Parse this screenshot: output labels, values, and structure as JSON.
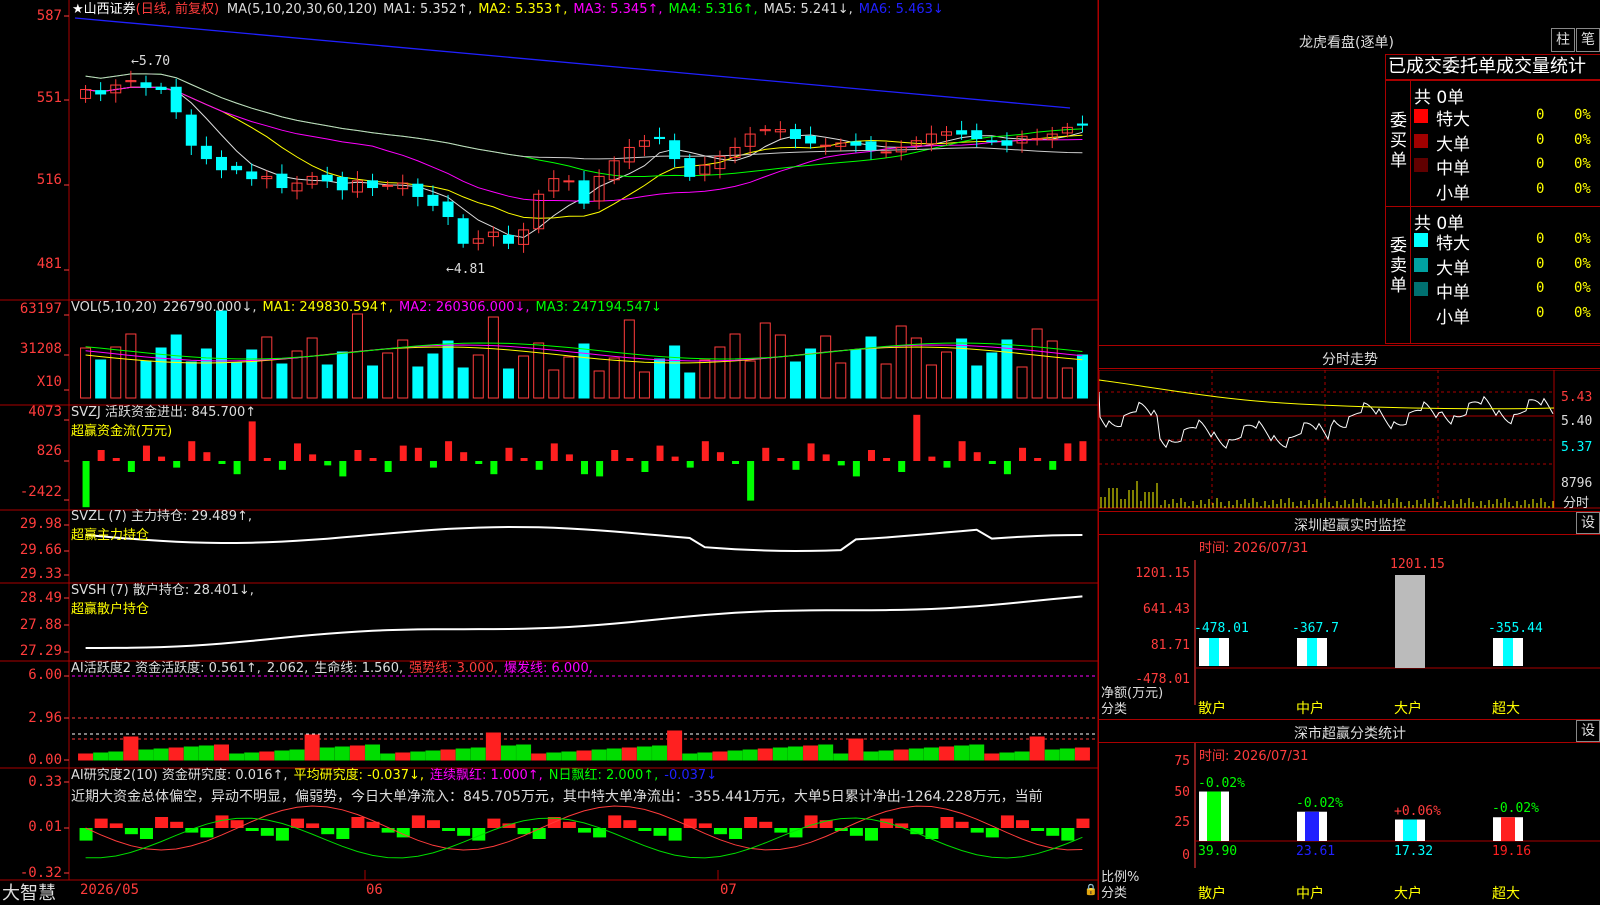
{
  "stock": {
    "name": "★山西证券",
    "period": "(日线, 前复权)"
  },
  "ma_header": [
    {
      "t": "MA(5,10,20,30,60,120)",
      "c": "#ddd"
    },
    {
      "t": "MA1: 5.352↑,",
      "c": "#ddd"
    },
    {
      "t": "MA2: 5.353↑,",
      "c": "#ffff00"
    },
    {
      "t": "MA3: 5.345↑,",
      "c": "#ff00ff"
    },
    {
      "t": "MA4: 5.316↑,",
      "c": "#00ff00"
    },
    {
      "t": "MA5: 5.241↓,",
      "c": "#ddd"
    },
    {
      "t": "MA6: 5.463↓",
      "c": "#2020ff"
    }
  ],
  "price_axis": [
    "587",
    "551",
    "516",
    "481"
  ],
  "price_annot": {
    "high": "5.70",
    "low": "4.81"
  },
  "vol_header": [
    {
      "t": "VOL(5,10,20)",
      "c": "#ddd"
    },
    {
      "t": "226790.000↓,",
      "c": "#ddd"
    },
    {
      "t": "MA1: 249830.594↑,",
      "c": "#ffff00"
    },
    {
      "t": "MA2: 260306.000↓,",
      "c": "#ff00ff"
    },
    {
      "t": "MA3: 247194.547↓",
      "c": "#00ff00"
    }
  ],
  "vol_axis": [
    "63197",
    "31208",
    "X10"
  ],
  "svzj": {
    "header": [
      {
        "t": "SVZJ  活跃资金进出: 845.700↑",
        "c": "#ddd"
      }
    ],
    "sub": "超赢资金流(万元)",
    "axis": [
      "4073",
      "826",
      "-2422"
    ]
  },
  "svzl": {
    "header": [
      {
        "t": "SVZL (7) 主力持仓: 29.489↑,",
        "c": "#ddd"
      }
    ],
    "sub": "超赢主力持仓",
    "axis": [
      "29.98",
      "29.66",
      "29.33"
    ]
  },
  "svsh": {
    "header": [
      {
        "t": "SVSH (7) 散户持仓: 28.401↓,",
        "c": "#ddd"
      }
    ],
    "sub": "超赢散户持仓",
    "axis": [
      "28.49",
      "27.88",
      "27.29"
    ]
  },
  "ai1": {
    "header": [
      {
        "t": "AI活跃度2 资金活跃度: 0.561↑,",
        "c": "#ddd"
      },
      {
        "t": "2.062,",
        "c": "#ddd"
      },
      {
        "t": "生命线: 1.560,",
        "c": "#ddd"
      },
      {
        "t": "强势线: 3.000,",
        "c": "#ff3c3c"
      },
      {
        "t": "爆发线: 6.000,",
        "c": "#ff00ff"
      }
    ],
    "axis": [
      "6.00",
      "2.96",
      "0.00"
    ]
  },
  "ai2": {
    "header": [
      {
        "t": "AI研究度2(10) 资金研究度: 0.016↑,",
        "c": "#ddd"
      },
      {
        "t": "平均研究度: -0.037↓,",
        "c": "#ffff00"
      },
      {
        "t": "连续飘红: 1.000↑,",
        "c": "#ff00ff"
      },
      {
        "t": "N日飘红: 2.000↑,",
        "c": "#00ff00"
      },
      {
        "t": "-0.037↓",
        "c": "#2020ff"
      }
    ],
    "note": "近期大资金总体偏空，异动不明显，偏弱势，今日大单净流入：845.705万元，其中特大单净流出：-355.441万元，大单5日累计净出-1264.228万元，当前",
    "axis": [
      "0.33",
      "0.01",
      "-0.32"
    ]
  },
  "bottom": {
    "brand": "大智慧",
    "dates": [
      "2026/05",
      "06",
      "07"
    ]
  },
  "dragon": {
    "title": "龙虎看盘(逐单)",
    "tab1": "柱",
    "tab2": "笔",
    "subtitle": "已成交委托单成交量统计",
    "buy_label": "委买单",
    "sell_label": "委卖单",
    "buy_total": "共 0单",
    "sell_total": "共 0单",
    "buy_rows": [
      {
        "name": "特大",
        "color": "#ff0000",
        "n": "0",
        "p": "0%"
      },
      {
        "name": "大单",
        "color": "#a00000",
        "n": "0",
        "p": "0%"
      },
      {
        "name": "中单",
        "color": "#600000",
        "n": "0",
        "p": "0%"
      },
      {
        "name": "小单",
        "color": "",
        "n": "0",
        "p": "0%"
      }
    ],
    "sell_rows": [
      {
        "name": "特大",
        "color": "#00ffff",
        "n": "0",
        "p": "0%"
      },
      {
        "name": "大单",
        "color": "#00a0a0",
        "n": "0",
        "p": "0%"
      },
      {
        "name": "中单",
        "color": "#007070",
        "n": "0",
        "p": "0%"
      },
      {
        "name": "小单",
        "color": "",
        "n": "0",
        "p": "0%"
      }
    ]
  },
  "intraday": {
    "title": "分时走势",
    "axis": [
      "5.43",
      "5.40",
      "5.37"
    ],
    "vol_label": "8796",
    "vol_unit": "分时"
  },
  "monitor": {
    "title": "深圳超赢实时监控",
    "btn": "设",
    "time": "时间: 2026/07/31",
    "axis": [
      "1201.15",
      "641.43",
      "81.71",
      "-478.01"
    ],
    "ylabel": "净额(万元)",
    "xlabel": "分类",
    "cats": [
      "散户",
      "中户",
      "大户",
      "超大"
    ],
    "values": [
      "-478.01",
      "-367.7",
      "1201.15",
      "-355.44"
    ]
  },
  "classify": {
    "title": "深市超赢分类统计",
    "btn": "设",
    "time": "时间: 2026/07/31",
    "axis": [
      "75",
      "50",
      "25",
      "0"
    ],
    "ylabel": "比例%",
    "xlabel": "分类",
    "cats": [
      "散户",
      "中户",
      "大户",
      "超大"
    ],
    "values": [
      "39.90",
      "23.61",
      "17.32",
      "19.16"
    ],
    "changes": [
      "-0.02%",
      "-0.02%",
      "+0.06%",
      "-0.02%"
    ]
  },
  "colors": {
    "up": "#ff3c3c",
    "down": "#00ffff",
    "grid": "#a00000",
    "green": "#00ff00"
  },
  "chart_data": {
    "type": "candlestick",
    "ohlc_close": [
      5.62,
      5.6,
      5.64,
      5.66,
      5.63,
      5.62,
      5.52,
      5.37,
      5.31,
      5.26,
      5.26,
      5.22,
      5.23,
      5.18,
      5.2,
      5.23,
      5.21,
      5.17,
      5.21,
      5.18,
      5.19,
      5.2,
      5.14,
      5.1,
      5.05,
      4.93,
      4.95,
      4.98,
      4.93,
      4.99,
      5.15,
      5.22,
      5.21,
      5.11,
      5.23,
      5.3,
      5.36,
      5.39,
      5.4,
      5.31,
      5.23,
      5.28,
      5.32,
      5.36,
      5.42,
      5.44,
      5.44,
      5.4,
      5.38,
      5.37,
      5.38,
      5.37,
      5.35,
      5.34,
      5.36,
      5.39,
      5.42,
      5.43,
      5.42,
      5.4,
      5.39,
      5.37,
      5.41,
      5.4,
      5.42,
      5.45,
      5.46
    ],
    "high": "5.70",
    "low": "4.81"
  }
}
